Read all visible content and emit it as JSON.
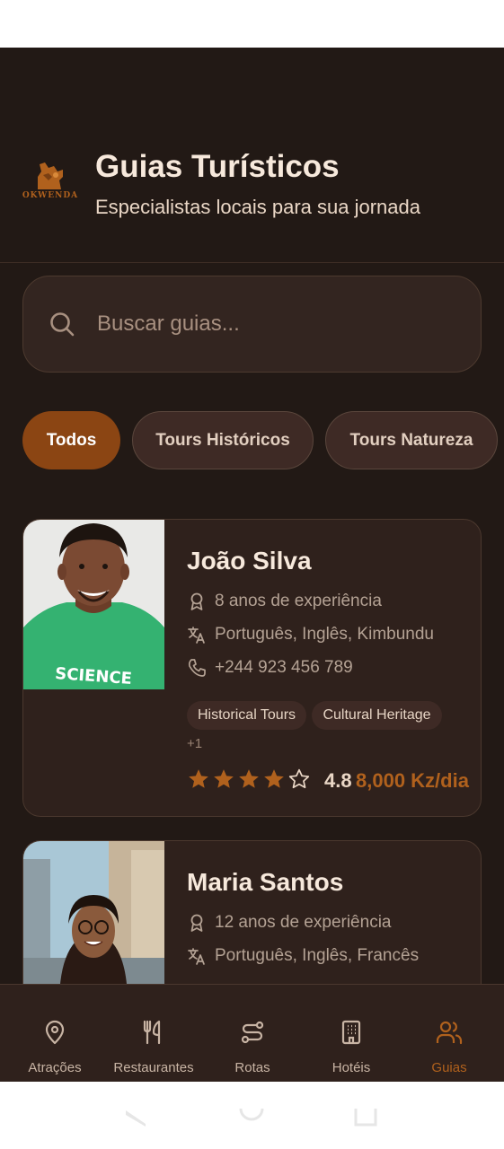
{
  "header": {
    "logo_text": "OKWENDA",
    "title": "Guias Turísticos",
    "subtitle": "Especialistas locais para sua jornada"
  },
  "search": {
    "placeholder": "Buscar guias..."
  },
  "filters": [
    {
      "label": "Todos",
      "active": true
    },
    {
      "label": "Tours Históricos",
      "active": false
    },
    {
      "label": "Tours Natureza",
      "active": false
    }
  ],
  "guides": [
    {
      "name": "João Silva",
      "experience": "8 anos de experiência",
      "languages": "Português, Inglês, Kimbundu",
      "phone": "+244 923 456 789",
      "tags": [
        "Historical Tours",
        "Cultural Heritage"
      ],
      "more_tags": "+1",
      "stars": 4,
      "rating": "4.8",
      "price": "8,000 Kz/dia"
    },
    {
      "name": "Maria Santos",
      "experience": "12 anos de experiência",
      "languages": "Português, Inglês, Francês"
    }
  ],
  "nav": [
    {
      "label": "Atrações",
      "icon": "map-pin-icon",
      "active": false
    },
    {
      "label": "Restaurantes",
      "icon": "utensils-icon",
      "active": false
    },
    {
      "label": "Rotas",
      "icon": "route-icon",
      "active": false
    },
    {
      "label": "Hotéis",
      "icon": "building-icon",
      "active": false
    },
    {
      "label": "Guias",
      "icon": "users-icon",
      "active": true
    }
  ],
  "colors": {
    "background": "#221915",
    "card": "#2f211c",
    "accent": "#8b4513",
    "accent_text": "#b0611d",
    "text_primary": "#f7e9dc"
  }
}
